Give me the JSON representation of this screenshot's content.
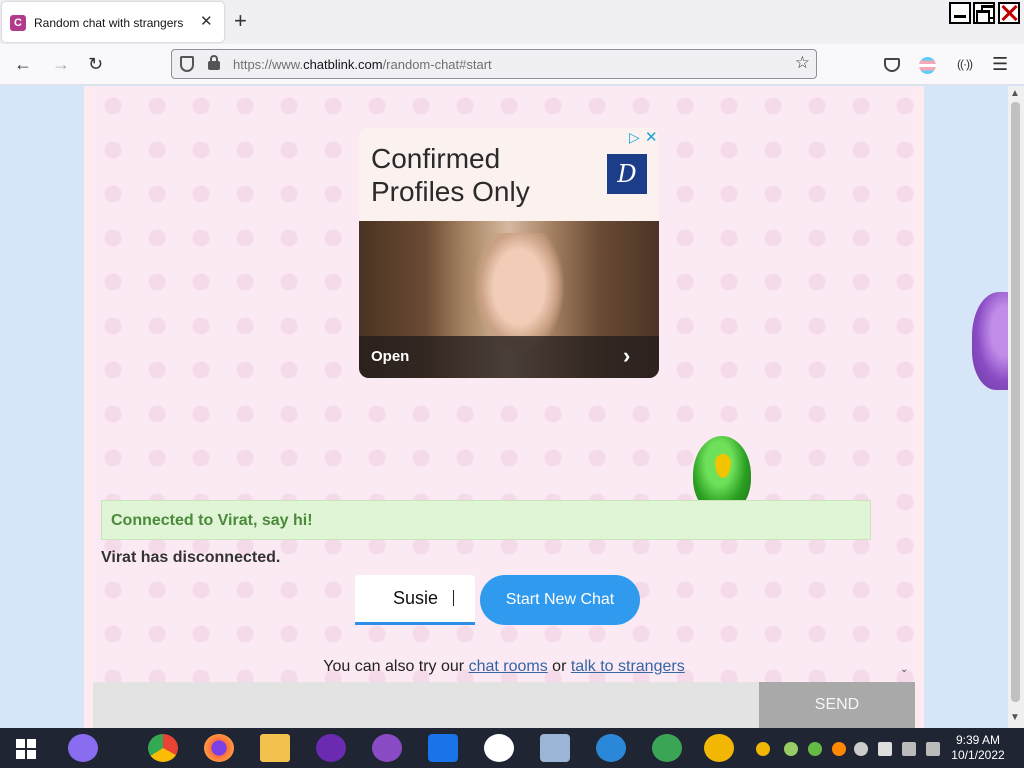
{
  "browser": {
    "tab_title": "Random chat with strangers",
    "tab_favicon_letter": "C",
    "url_prefix": "https://www.",
    "url_host": "chatblink.com",
    "url_path": "/random-chat#start"
  },
  "ad": {
    "headline": "Confirmed\nProfiles Only",
    "logo_letter": "D",
    "open_label": "Open"
  },
  "chat": {
    "connected_msg": "Connected to Virat, say hi!",
    "disconnected_msg": "Virat has disconnected.",
    "name_value": "Susie",
    "start_button": "Start New Chat",
    "alt_prefix": "You can also try our",
    "alt_link1": "chat rooms",
    "alt_or": "or",
    "alt_link2": "talk to strangers",
    "send_button": "SEND"
  },
  "taskbar": {
    "time": "9:39 AM",
    "date": "10/1/2022"
  },
  "colors": {
    "accent": "#2f9aee",
    "connected_bg": "#e0f5d5",
    "connected_text": "#4a8a3a",
    "link": "#3465a4"
  }
}
